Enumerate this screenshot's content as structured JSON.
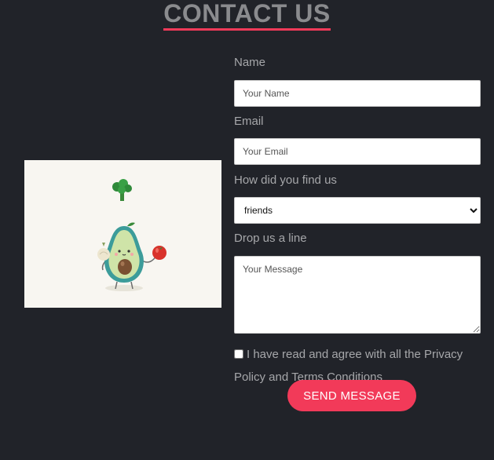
{
  "page": {
    "title": "CONTACT US"
  },
  "colors": {
    "accent": "#f23a59",
    "background": "#212329",
    "text": "#a6a7aa"
  },
  "illustration": {
    "icon": "avocado-mascot-icon"
  },
  "form": {
    "name": {
      "label": "Name",
      "placeholder": "Your Name"
    },
    "email": {
      "label": "Email",
      "placeholder": "Your Email"
    },
    "source": {
      "label": "How did you find us",
      "selected": "friends",
      "options": [
        "friends"
      ]
    },
    "message": {
      "label": "Drop us a line",
      "placeholder": "Your Message"
    },
    "agree_text": "I have read and agree with all the Privacy Policy and Terms Conditions",
    "submit_label": "SEND MESSAGE"
  }
}
